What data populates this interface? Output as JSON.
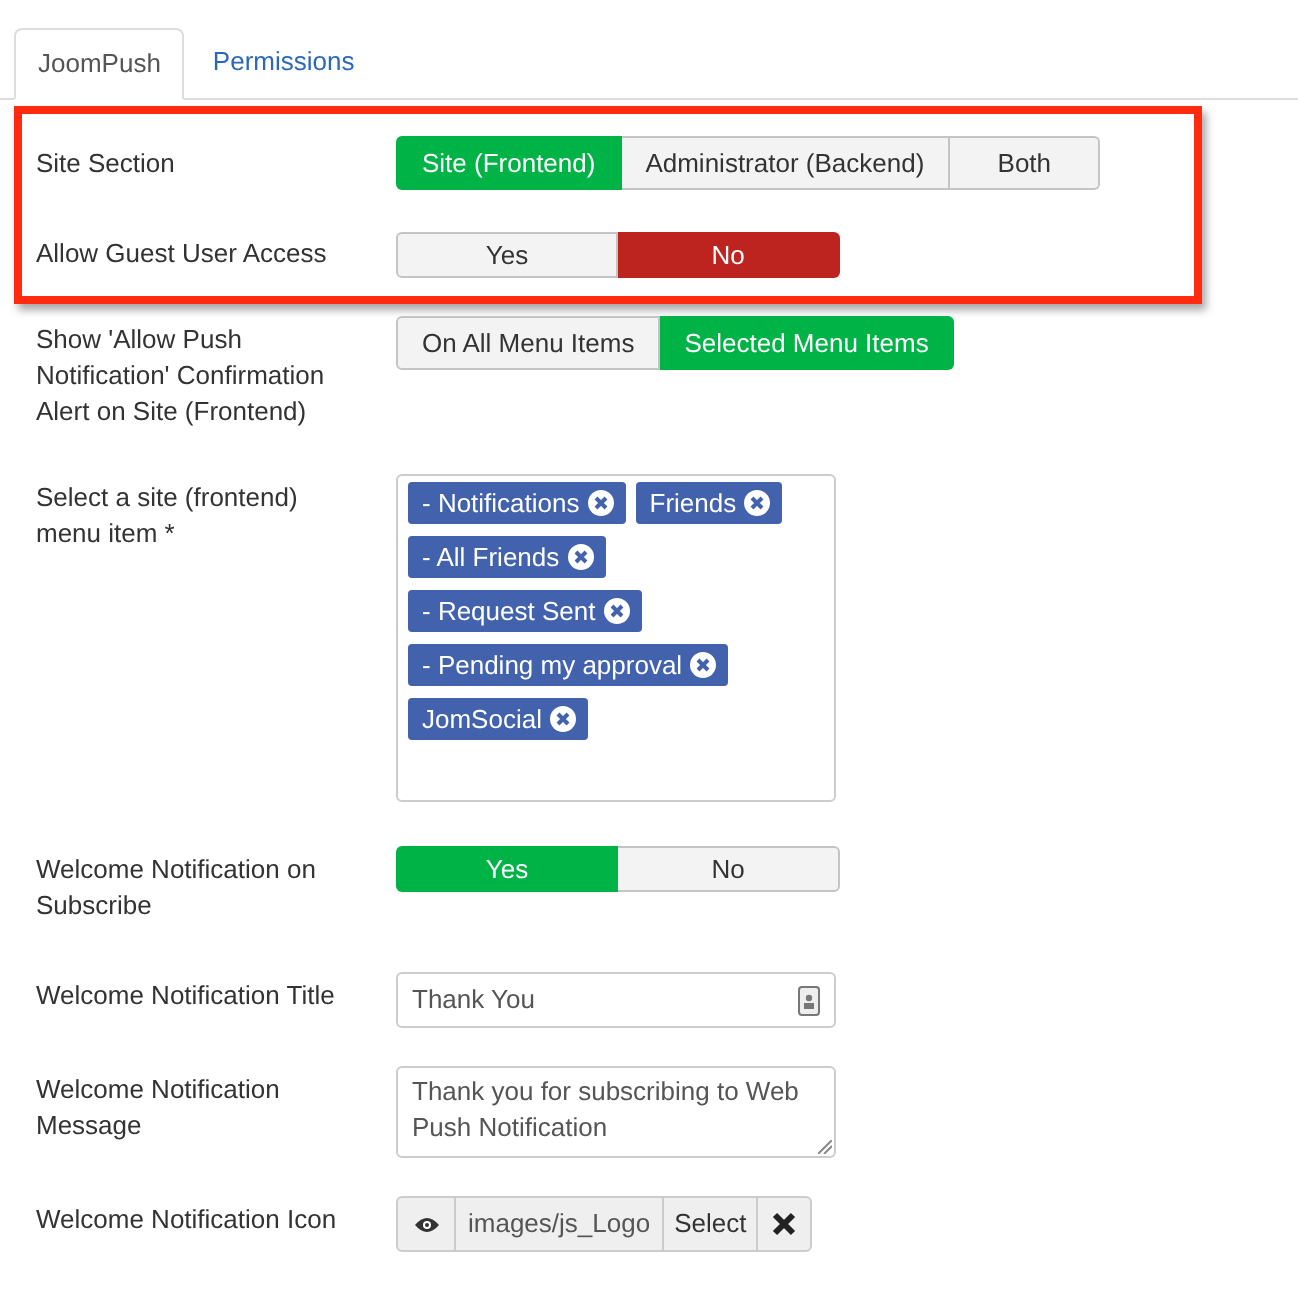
{
  "tabs": [
    {
      "label": "JoomPush",
      "selected": true
    },
    {
      "label": "Permissions",
      "selected": false
    }
  ],
  "fields": [
    {
      "kind": "choice",
      "label": "Site Section",
      "highlighted": true,
      "options": [
        {
          "label": "Site (Frontend)",
          "selected": true,
          "color": "#00b347"
        },
        {
          "label": "Administrator (Backend)",
          "selected": false
        },
        {
          "label": "Both",
          "selected": false
        }
      ]
    },
    {
      "kind": "toggle",
      "label": "Allow Guest User Access",
      "highlighted": true,
      "options": [
        {
          "label": "Yes",
          "selected": false
        },
        {
          "label": "No",
          "selected": true,
          "color": "#bd2420"
        }
      ]
    },
    {
      "kind": "choice",
      "label": "Show 'Allow Push Notification' Confirmation Alert on Site (Frontend)",
      "highlighted": false,
      "options": [
        {
          "label": "On All Menu Items",
          "selected": false
        },
        {
          "label": "Selected Menu Items",
          "selected": true,
          "color": "#00b347"
        }
      ]
    },
    {
      "kind": "tags",
      "label": "Select a site (frontend) menu item *",
      "highlighted": false,
      "tags": [
        "- Notifications",
        "Friends",
        "- All Friends",
        "- Request Sent",
        "- Pending my approval",
        "JomSocial"
      ]
    },
    {
      "kind": "toggle",
      "label": "Welcome Notification on Subscribe",
      "highlighted": false,
      "options": [
        {
          "label": "Yes",
          "selected": true,
          "color": "#00b347"
        },
        {
          "label": "No",
          "selected": false
        }
      ]
    },
    {
      "kind": "text",
      "label": "Welcome Notification Title",
      "highlighted": false,
      "value": "Thank You"
    },
    {
      "kind": "textarea",
      "label": "Welcome Notification Message",
      "highlighted": false,
      "value": "Thank you for subscribing to Web Push Notification"
    },
    {
      "kind": "media",
      "label": "Welcome Notification Icon",
      "highlighted": false,
      "value": "images/js_Logo",
      "button": "Select"
    }
  ]
}
